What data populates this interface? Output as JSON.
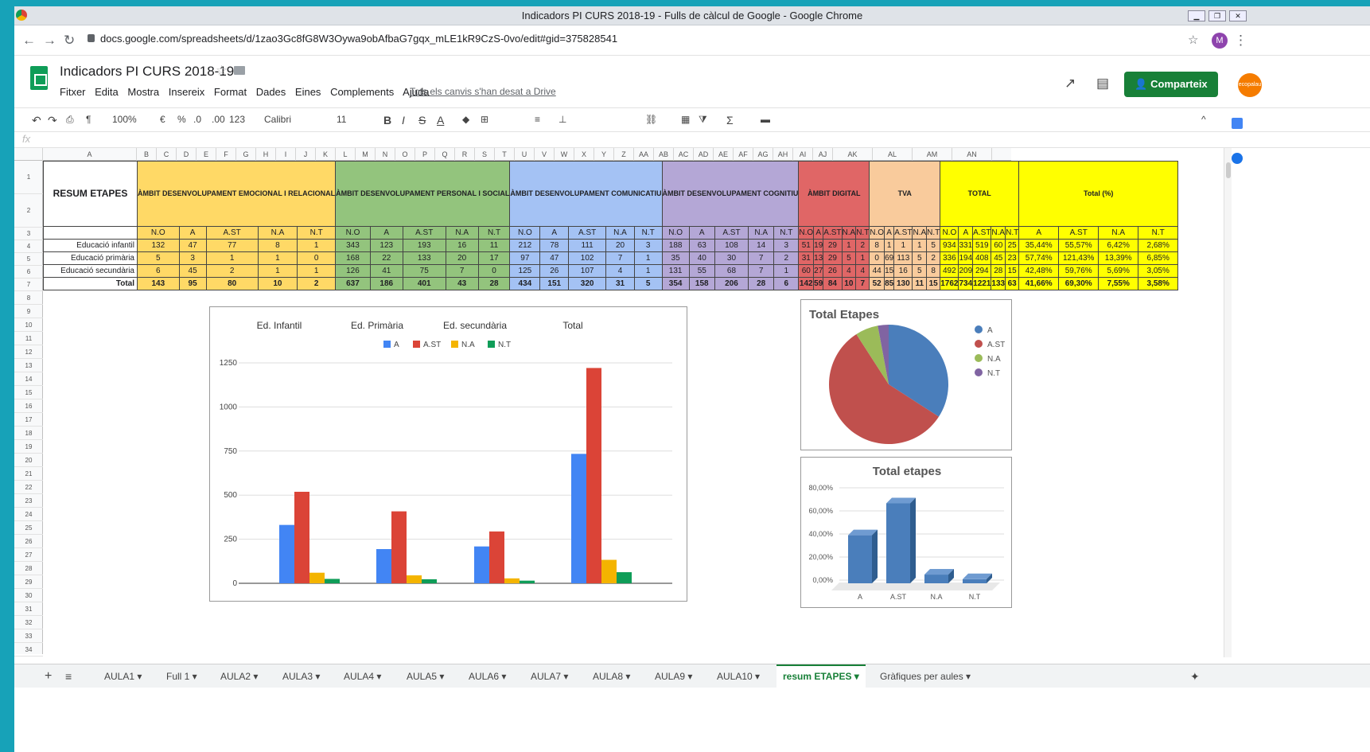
{
  "browser": {
    "title": "Indicadors PI CURS 2018-19 - Fulls de càlcul de Google - Google Chrome",
    "url": "docs.google.com/spreadsheets/d/1zao3Gc8fG8W3Oywa9obAfbaG7gqx_mLE1kR9CzS-0vo/edit#gid=375828541",
    "profile": "M"
  },
  "doc": {
    "title": "Indicadors PI CURS 2018-19",
    "menu": [
      "Fitxer",
      "Edita",
      "Mostra",
      "Insereix",
      "Format",
      "Dades",
      "Eines",
      "Complements",
      "Ajuda"
    ],
    "saved": "Tots els canvis s'han desat a Drive",
    "share": "Comparteix",
    "avatar": "ecopalau"
  },
  "toolbar": {
    "zoom": "100%",
    "currency": "€",
    "percent": "%",
    "dec_less": ".0",
    "dec_more": ".00",
    "fmt": "123",
    "font": "Calibri",
    "size": "11",
    "bold": "B",
    "italic": "I",
    "strike": "S",
    "color": "A",
    "sigma": "Σ"
  },
  "fx": "fx",
  "columns": [
    "A",
    "B",
    "C",
    "D",
    "E",
    "F",
    "G",
    "H",
    "I",
    "J",
    "K",
    "L",
    "M",
    "N",
    "O",
    "P",
    "Q",
    "R",
    "S",
    "T",
    "U",
    "V",
    "W",
    "X",
    "Y",
    "Z",
    "AA",
    "AB",
    "AC",
    "AD",
    "AE",
    "AF",
    "AG",
    "AH",
    "AI",
    "AJ",
    "AK",
    "AL",
    "AM",
    "AN"
  ],
  "rows": [
    "1",
    "2",
    "3",
    "4",
    "5",
    "6",
    "7",
    "8",
    "9",
    "10",
    "11",
    "12",
    "13",
    "14",
    "15",
    "16",
    "17",
    "18",
    "19",
    "20",
    "21",
    "22",
    "23",
    "24",
    "25",
    "26",
    "27",
    "28",
    "29",
    "30",
    "31",
    "32",
    "33",
    "34"
  ],
  "table": {
    "title": "RESUM ETAPES",
    "groups": [
      "ÀMBIT DESENVOLUPAMENT EMOCIONAL I RELACIONAL",
      "ÀMBIT DESENVOLUPAMENT PERSONAL I SOCIAL",
      "ÀMBIT DESENVOLUPAMENT COMUNICATIU",
      "ÀMBIT  DESENVOLUPAMENT COGNITIU",
      "ÀMBIT DIGITAL",
      "TVA",
      "TOTAL",
      "Total (%)"
    ],
    "sub": [
      "N.O",
      "A",
      "A.ST",
      "N.A",
      "N.T"
    ],
    "subpct": [
      "A",
      "A.ST",
      "N.A",
      "N.T"
    ],
    "data": [
      {
        "label": "Educació infantil",
        "v": [
          "132",
          "47",
          "77",
          "8",
          "1",
          "343",
          "123",
          "193",
          "16",
          "11",
          "212",
          "78",
          "111",
          "20",
          "3",
          "188",
          "63",
          "108",
          "14",
          "3",
          "51",
          "19",
          "29",
          "1",
          "2",
          "8",
          "1",
          "1",
          "1",
          "5",
          "934",
          "331",
          "519",
          "60",
          "25",
          "35,44%",
          "55,57%",
          "6,42%",
          "2,68%"
        ]
      },
      {
        "label": "Educació primària",
        "v": [
          "5",
          "3",
          "1",
          "1",
          "0",
          "168",
          "22",
          "133",
          "20",
          "17",
          "97",
          "47",
          "102",
          "7",
          "1",
          "35",
          "40",
          "30",
          "7",
          "2",
          "31",
          "13",
          "29",
          "5",
          "1",
          "0",
          "69",
          "113",
          "5",
          "2",
          "336",
          "194",
          "408",
          "45",
          "23",
          "57,74%",
          "121,43%",
          "13,39%",
          "6,85%"
        ]
      },
      {
        "label": "Educació secundària",
        "v": [
          "6",
          "45",
          "2",
          "1",
          "1",
          "126",
          "41",
          "75",
          "7",
          "0",
          "125",
          "26",
          "107",
          "4",
          "1",
          "131",
          "55",
          "68",
          "7",
          "1",
          "60",
          "27",
          "26",
          "4",
          "4",
          "44",
          "15",
          "16",
          "5",
          "8",
          "492",
          "209",
          "294",
          "28",
          "15",
          "42,48%",
          "59,76%",
          "5,69%",
          "3,05%"
        ]
      },
      {
        "label": "Total",
        "v": [
          "143",
          "95",
          "80",
          "10",
          "2",
          "637",
          "186",
          "401",
          "43",
          "28",
          "434",
          "151",
          "320",
          "31",
          "5",
          "354",
          "158",
          "206",
          "28",
          "6",
          "142",
          "59",
          "84",
          "10",
          "7",
          "52",
          "85",
          "130",
          "11",
          "15",
          "1762",
          "734",
          "1221",
          "133",
          "63",
          "41,66%",
          "69,30%",
          "7,55%",
          "3,58%"
        ]
      }
    ]
  },
  "chart_data": [
    {
      "type": "bar",
      "categories": [
        "Ed. Infantil",
        "Ed. Primària",
        "Ed. secundària",
        "Total"
      ],
      "series": [
        {
          "name": "A",
          "values": [
            331,
            194,
            209,
            734
          ]
        },
        {
          "name": "A.ST",
          "values": [
            519,
            408,
            294,
            1221
          ]
        },
        {
          "name": "N.A",
          "values": [
            60,
            45,
            28,
            133
          ]
        },
        {
          "name": "N.T",
          "values": [
            25,
            23,
            15,
            63
          ]
        }
      ],
      "ylim": [
        0,
        1250
      ],
      "yticks": [
        "0",
        "250",
        "500",
        "750",
        "1000",
        "1250"
      ],
      "colors": [
        "#4285f4",
        "#db4437",
        "#f4b400",
        "#0f9d58"
      ],
      "legend": "top"
    },
    {
      "type": "pie",
      "title": "Total Etapes",
      "labels": [
        "A",
        "A.ST",
        "N.A",
        "N.T"
      ],
      "values": [
        734,
        1221,
        133,
        63
      ],
      "colors": [
        "#4a7ebb",
        "#c0504d",
        "#9bbb59",
        "#8064a2"
      ],
      "legend": "right"
    },
    {
      "type": "bar",
      "title": "Total etapes",
      "categories": [
        "A",
        "A.ST",
        "N.A",
        "N.T"
      ],
      "values": [
        41.66,
        69.3,
        7.55,
        3.58
      ],
      "yticks": [
        "0,00%",
        "20,00%",
        "40,00%",
        "60,00%",
        "80,00%"
      ],
      "ylim": [
        0,
        80
      ],
      "color": "#4a7ebb"
    }
  ],
  "sheet_tabs": [
    "AULA1",
    "Full 1",
    "AULA2",
    "AULA3",
    "AULA4",
    "AULA5",
    "AULA6",
    "AULA7",
    "AULA8",
    "AULA9",
    "AULA10",
    "resum ETAPES",
    "Gràfiques per aules"
  ],
  "active_tab": "resum ETAPES"
}
